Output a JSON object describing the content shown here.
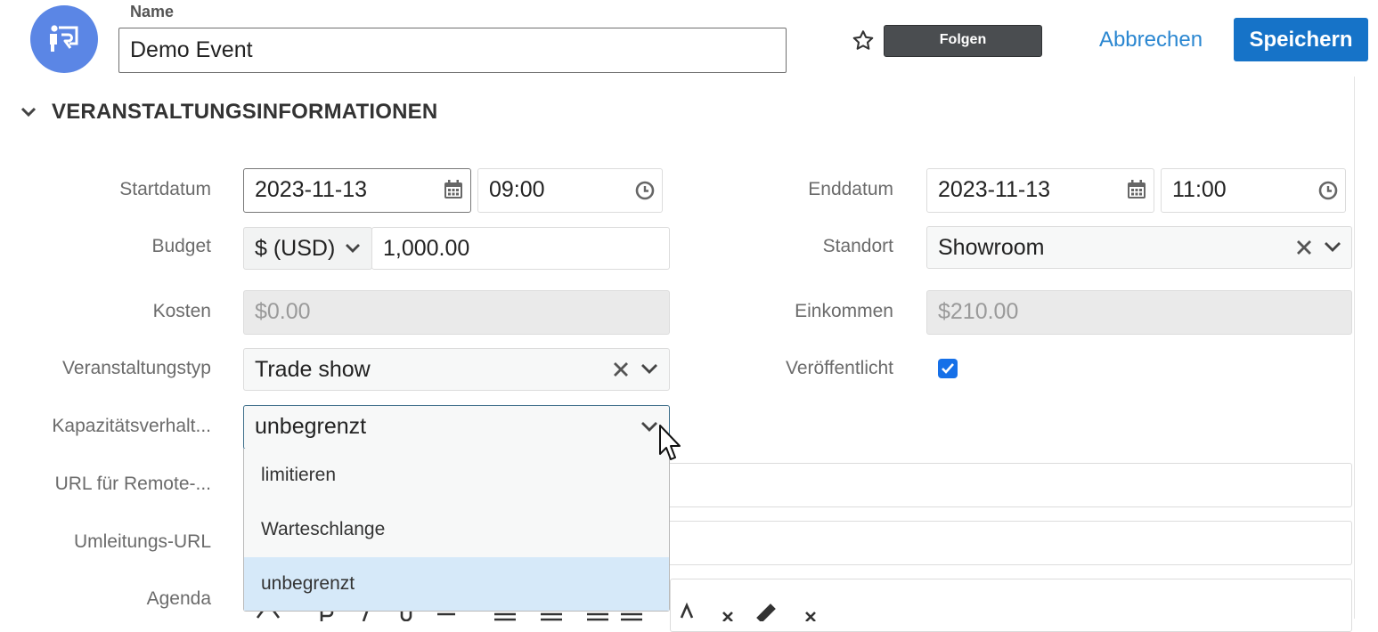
{
  "header": {
    "name_label": "Name",
    "name_value": "Demo Event",
    "follow_label": "Folgen",
    "cancel_label": "Abbrechen",
    "save_label": "Speichern"
  },
  "section": {
    "title": "VERANSTALTUNGSINFORMATIONEN"
  },
  "fields": {
    "start_label": "Startdatum",
    "start_date": "2023-11-13",
    "start_time": "09:00",
    "end_label": "Enddatum",
    "end_date": "2023-11-13",
    "end_time": "11:00",
    "budget_label": "Budget",
    "budget_currency": "$ (USD)",
    "budget_amount": "1,000.00",
    "location_label": "Standort",
    "location_value": "Showroom",
    "cost_label": "Kosten",
    "cost_value": "$0.00",
    "income_label": "Einkommen",
    "income_value": "$210.00",
    "type_label": "Veranstaltungstyp",
    "type_value": "Trade show",
    "published_label": "Veröffentlicht",
    "published_checked": true,
    "capacity_label": "Kapazitätsverhalt...",
    "capacity_value": "unbegrenzt",
    "remote_url_label": "URL für Remote-...",
    "redirect_url_label": "Umleitungs-URL",
    "agenda_label": "Agenda"
  },
  "capacity_dropdown": {
    "options": [
      "limitieren",
      "Warteschlange",
      "unbegrenzt"
    ],
    "selected": "unbegrenzt"
  },
  "colors": {
    "primary": "#1673c8",
    "link": "#2b87d1",
    "avatar": "#5b86e5",
    "checkbox": "#1670e8",
    "selected_option": "#d6e9f9"
  },
  "icons": {
    "avatar": "presentation-icon",
    "favorite": "star-outline-icon",
    "section_toggle": "chevron-down-icon",
    "date": "calendar-icon",
    "time": "clock-icon",
    "clear": "close-icon",
    "open": "chevron-down-icon",
    "cursor": "mouse-pointer-icon"
  }
}
